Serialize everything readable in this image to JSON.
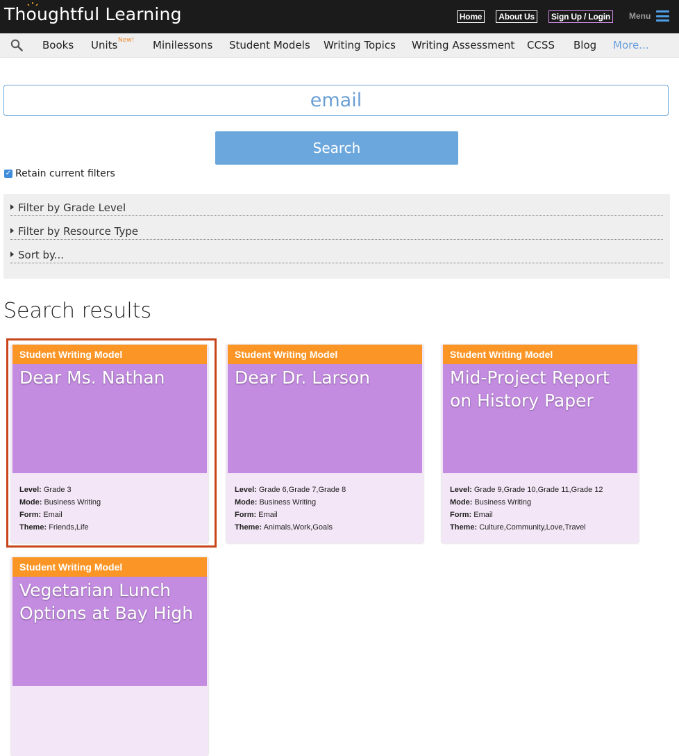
{
  "header": {
    "logo_text": "Thoughtful Learning",
    "links": [
      "Home",
      "About Us",
      "Sign Up / Login"
    ],
    "menu_label": "Menu"
  },
  "nav": {
    "items": [
      "Books",
      "Units",
      "Minilessons",
      "Student Models",
      "Writing Topics",
      "Writing Assessment",
      "CCSS",
      "Blog",
      "More..."
    ],
    "new_badge": "New!"
  },
  "search": {
    "value": "email",
    "button_label": "Search",
    "retain_label": "Retain current filters",
    "retain_checked": true
  },
  "filters": [
    "Filter by Grade Level",
    "Filter by Resource Type",
    "Sort by..."
  ],
  "results": {
    "heading": "Search results",
    "cards": [
      {
        "category": "Student Writing Model",
        "title": "Dear Ms. Nathan",
        "level_label": "Level:",
        "level": "Grade 3",
        "mode_label": "Mode:",
        "mode": "Business Writing",
        "form_label": "Form:",
        "form": "Email",
        "theme_label": "Theme:",
        "theme": "Friends,Life"
      },
      {
        "category": "Student Writing Model",
        "title": "Dear Dr. Larson",
        "level_label": "Level:",
        "level": "Grade 6,Grade 7,Grade 8",
        "mode_label": "Mode:",
        "mode": "Business Writing",
        "form_label": "Form:",
        "form": "Email",
        "theme_label": "Theme:",
        "theme": "Animals,Work,Goals"
      },
      {
        "category": "Student Writing Model",
        "title": "Mid-Project Report on History Paper",
        "level_label": "Level:",
        "level": "Grade 9,Grade 10,Grade 11,Grade 12",
        "mode_label": "Mode:",
        "mode": "Business Writing",
        "form_label": "Form:",
        "form": "Email",
        "theme_label": "Theme:",
        "theme": "Culture,Community,Love,Travel"
      },
      {
        "category": "Student Writing Model",
        "title": "Vegetarian Lunch Options at Bay High"
      }
    ]
  },
  "colors": {
    "topbar": "#1b1b1b",
    "accent_blue": "#6ba7dd",
    "card_orange": "#fa9526",
    "card_purple": "#c38ce0",
    "selection": "#c8451a"
  }
}
